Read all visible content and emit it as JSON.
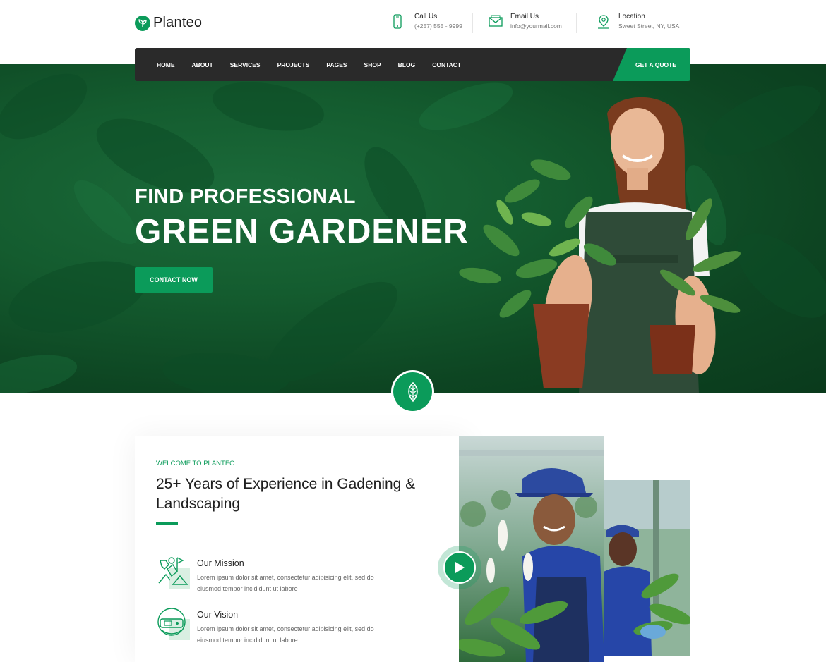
{
  "brand": {
    "name": "Planteo",
    "accent": "#0b9b5a",
    "dark": "#2a2a2a"
  },
  "header": {
    "call": {
      "label": "Call Us",
      "value": "(+257) 555 - 9999",
      "icon": "phone-icon"
    },
    "email": {
      "label": "Email Us",
      "value": "info@yourmail.com",
      "icon": "envelope-icon"
    },
    "location": {
      "label": "Location",
      "value": "Sweet Street, NY, USA",
      "icon": "map-pin-icon"
    }
  },
  "nav": {
    "items": [
      "HOME",
      "ABOUT",
      "SERVICES",
      "PROJECTS",
      "PAGES",
      "SHOP",
      "BLOG",
      "CONTACT"
    ],
    "cta": "GET A QUOTE"
  },
  "hero": {
    "subtitle": "FIND PROFESSIONAL",
    "title": "GREEN GARDENER",
    "button": "CONTACT NOW"
  },
  "about": {
    "kicker": "WELCOME TO PLANTEO",
    "title": "25+ Years of Experience in Gadening & Landscaping",
    "features": [
      {
        "title": "Our Mission",
        "text": "Lorem ipsum dolor sit amet, consectetur adipisicing elit, sed do eiusmod tempor incididunt ut labore",
        "icon": "gardener-icon"
      },
      {
        "title": "Our Vision",
        "text": "Lorem ipsum dolor sit amet, consectetur adipisicing elit, sed do eiusmod tempor incididunt ut labore",
        "icon": "vision-icon"
      }
    ]
  }
}
